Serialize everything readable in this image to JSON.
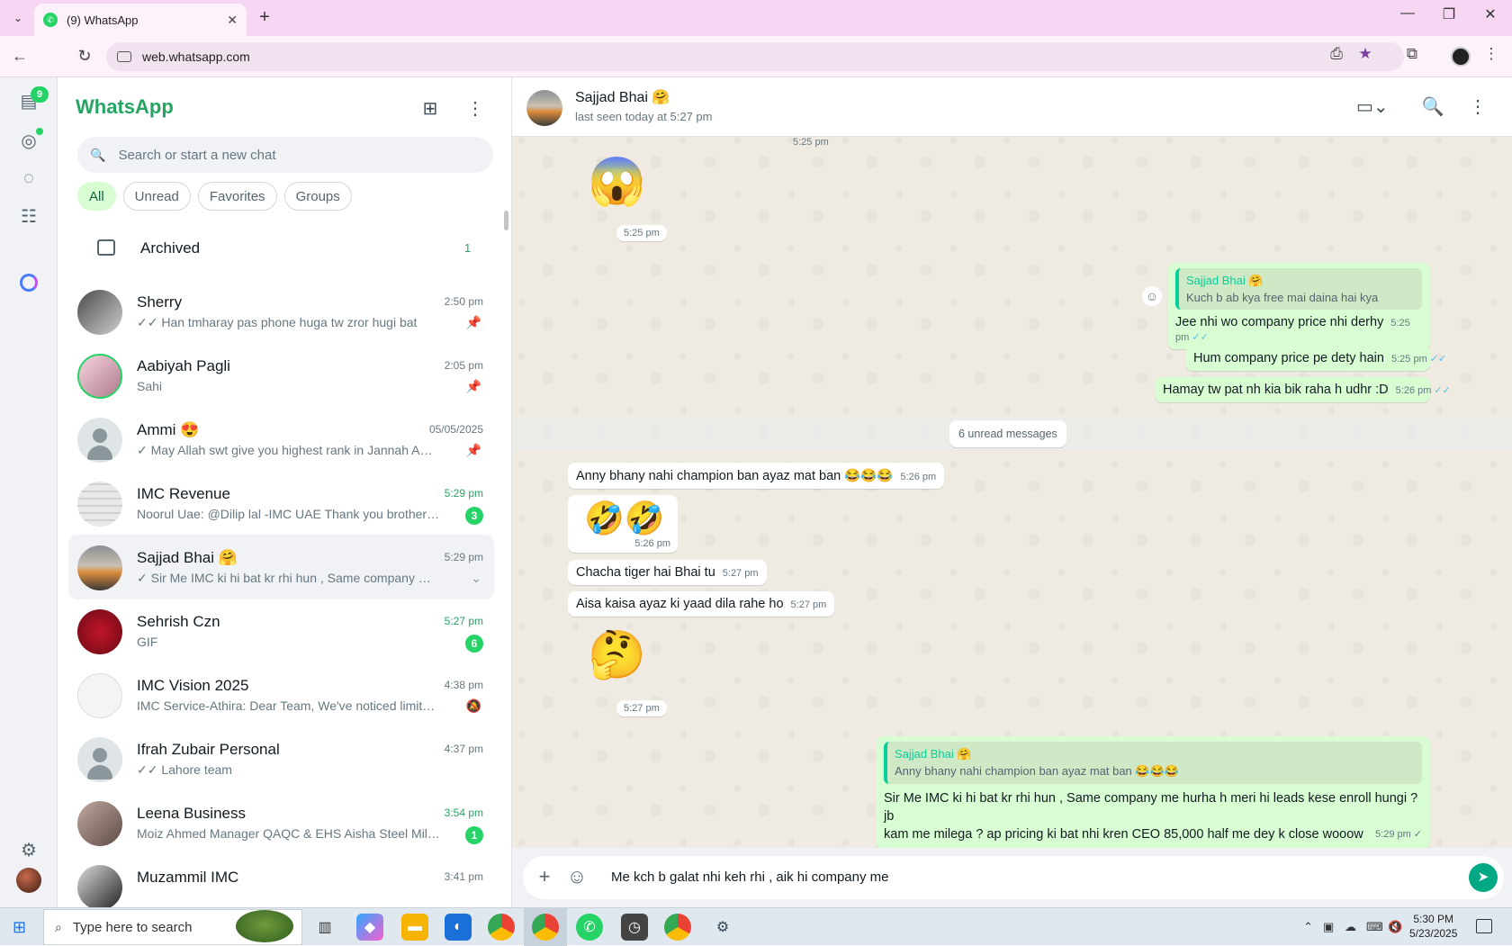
{
  "browser": {
    "tab_title": "(9) WhatsApp",
    "url": "web.whatsapp.com"
  },
  "rail": {
    "chats_badge": "9"
  },
  "sidebar": {
    "title": "WhatsApp",
    "search_placeholder": "Search or start a new chat",
    "filters": [
      "All",
      "Unread",
      "Favorites",
      "Groups"
    ],
    "archived_label": "Archived",
    "archived_count": "1",
    "chats": [
      {
        "name": "Sherry",
        "time": "2:50 pm",
        "preview": "✓✓ Han tmharay pas phone huga tw zror hugi bat",
        "pinned": true
      },
      {
        "name": "Aabiyah Pagli",
        "time": "2:05 pm",
        "preview": "Sahi",
        "pinned": true
      },
      {
        "name": "Ammi 😍",
        "time": "05/05/2025",
        "preview": "✓ May Allah swt give you highest rank in Jannah  Ame...",
        "pinned": true
      },
      {
        "name": "IMC Revenue",
        "time": "5:29 pm",
        "preview": "Noorul Uae: @Dilip lal -IMC UAE  Thank you brother for...",
        "badge": "3"
      },
      {
        "name": "Sajjad Bhai 🤗",
        "time": "5:29 pm",
        "preview": "✓ Sir Me IMC ki hi bat kr rhi hun , Same company me ..."
      },
      {
        "name": "Sehrish Czn",
        "time": "5:27 pm",
        "preview": "GIF",
        "badge": "6"
      },
      {
        "name": "IMC Vision 2025",
        "time": "4:38 pm",
        "preview": "IMC Service-Athira: Dear Team, We've noticed limited b...",
        "muted": true
      },
      {
        "name": "Ifrah Zubair Personal",
        "time": "4:37 pm",
        "preview": "✓✓ Lahore team"
      },
      {
        "name": "Leena Business",
        "time": "3:54 pm",
        "preview": "Moiz Ahmed Manager QAQC & EHS Aisha Steel Mills Li...",
        "badge": "1"
      },
      {
        "name": "Muzammil IMC",
        "time": "3:41 pm",
        "preview": ""
      }
    ]
  },
  "conversation": {
    "contact_name": "Sajjad Bhai 🤗",
    "last_seen": "last seen today at 5:27 pm",
    "top_partial_time": "5:25 pm",
    "messages": {
      "m1_emoji": "😱",
      "m1_time": "5:25 pm",
      "reply_quote_author": "Sajjad Bhai 🤗",
      "reply_quote_text": "Kuch b ab kya free mai daina hai kya",
      "m2_text": "Jee nhi wo company price nhi derhy",
      "m2_time": "5:25 pm",
      "m3_text": "Hum company price pe dety hain",
      "m3_time": "5:25 pm",
      "m4_text": "Hamay tw pat nh kia bik raha h udhr :D",
      "m4_time": "5:26 pm",
      "unread_label": "6 unread messages",
      "m5_text": "Anny bhany nahi champion ban ayaz mat ban 😂😂😂",
      "m5_time": "5:26 pm",
      "m6_emoji": "🤣🤣",
      "m6_time": "5:26 pm",
      "m7_text": "Chacha tiger hai Bhai tu",
      "m7_time": "5:27 pm",
      "m8_text": "Aisa kaisa ayaz ki yaad dila rahe ho",
      "m8_time": "5:27 pm",
      "m9_emoji": "🤔",
      "m9_time": "5:27 pm",
      "last_quote_author": "Sajjad Bhai 🤗",
      "last_quote_text": "Anny bhany nahi champion ban ayaz mat ban 😂😂😂",
      "last_line1": "Sir Me IMC ki hi bat kr rhi hun , Same company me hurha h meri hi leads kese enroll hungi ? jb",
      "last_line2": "kam me milega ? ap pricing ki bat nhi kren  CEO 85,000 half me dey k close wooow",
      "last_time": "5:29 pm"
    },
    "composer_text": "Me kch b galat nhi keh rhi , aik hi company me"
  },
  "taskbar": {
    "search_placeholder": "Type here to search",
    "time": "5:30 PM",
    "date": "5/23/2025"
  },
  "colors": {
    "brand_green": "#25d366",
    "outgoing_bubble": "#d9fdd3",
    "read_ticks": "#53bdeb"
  }
}
